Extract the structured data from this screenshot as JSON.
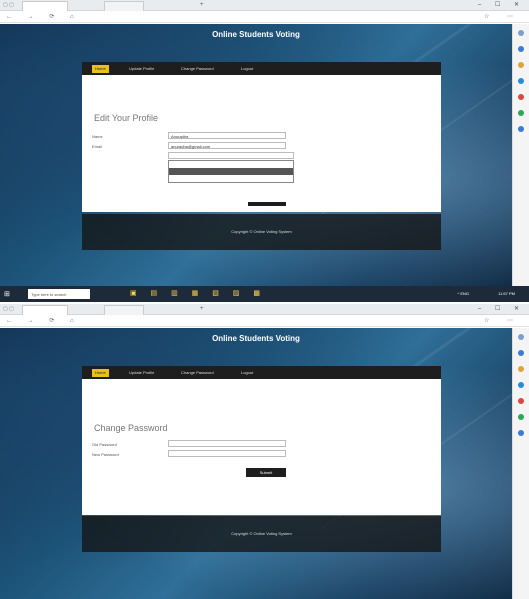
{
  "browser": {
    "tab_label": "",
    "tab2_label": "",
    "new_tab": "+",
    "window_controls": "– ☐ ✕",
    "nav_buttons": "← → ⟳ ⌂",
    "url_host": "",
    "url_path": "",
    "tool_icons": "☆ ⋯"
  },
  "site": {
    "title": "Online Students Voting",
    "nav": [
      "Home",
      "Update Profile",
      "Change Password",
      "Logout"
    ]
  },
  "screen1": {
    "panel_title": "Edit Your Profile",
    "fields": [
      {
        "label": "Name",
        "value": "Anuradha"
      },
      {
        "label": "Email",
        "value": "anuradha@gmail.com"
      },
      {
        "label": "",
        "value": ""
      }
    ],
    "dropdown_options": [
      "",
      "",
      ""
    ],
    "footer": "Copyright © Online Voting System"
  },
  "screen2": {
    "panel_title": "Change Password",
    "fields": [
      {
        "label": "Old Password",
        "value": ""
      },
      {
        "label": "New Password",
        "value": ""
      }
    ],
    "submit_label": "Submit",
    "footer": "Copyright © Online Voting System"
  },
  "taskbar": {
    "start": "⊞",
    "search_placeholder": "Type here to search",
    "apps": "▣ ▤ ▥ ▦ ▧ ▨ ▩",
    "tray": "^ ENG",
    "clock": "11:57 PM"
  },
  "colors": {
    "accent": "#e6c11a",
    "navbar": "#1e1e1e",
    "background_blue": "#1d5479"
  }
}
